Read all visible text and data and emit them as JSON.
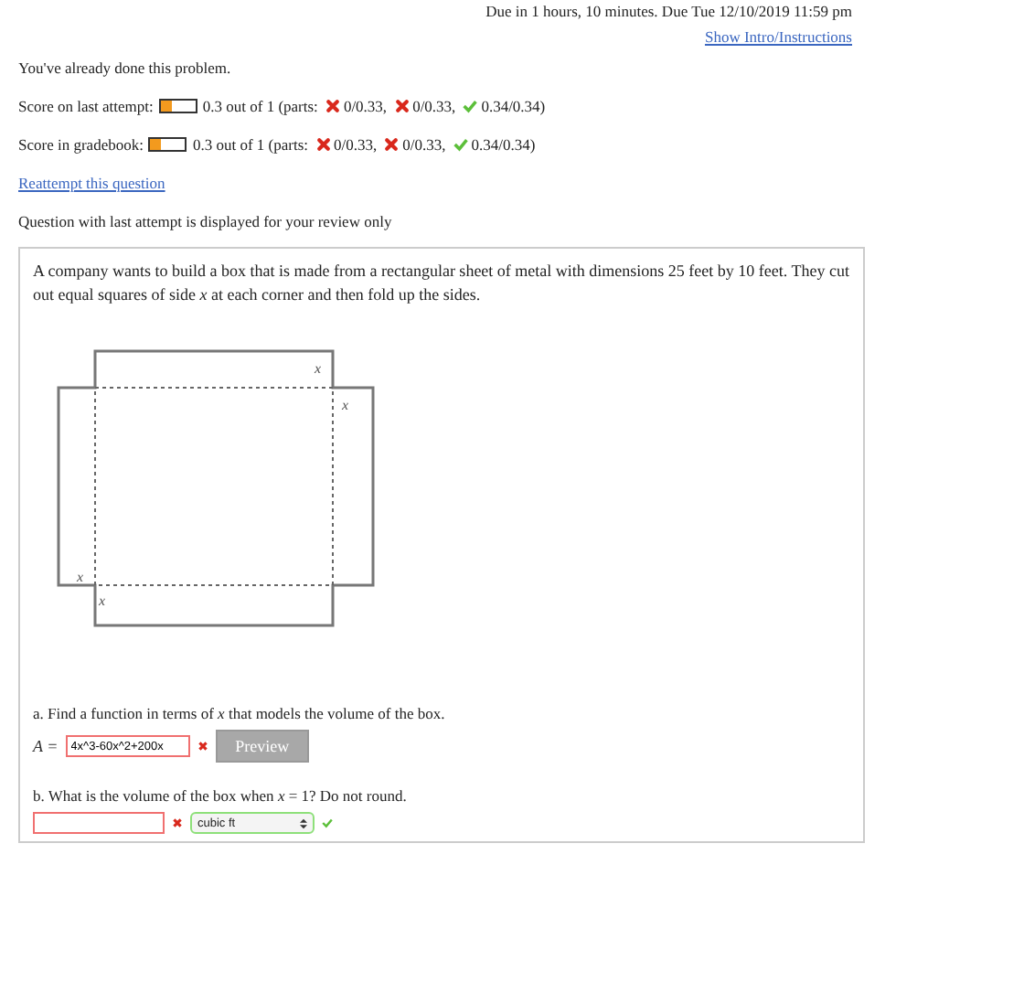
{
  "due": "Due in 1 hours, 10 minutes. Due Tue 12/10/2019 11:59 pm",
  "intro_link": "Show Intro/Instructions",
  "notice": "You've already done this problem.",
  "scores": [
    {
      "label": "Score on last attempt:",
      "level": 0.3,
      "score": "0.3 out of 1 (parts:",
      "parts": [
        {
          "correct": false,
          "text": "0/0.33,"
        },
        {
          "correct": false,
          "text": "0/0.33,"
        },
        {
          "correct": true,
          "text": "0.34/0.34)"
        }
      ]
    },
    {
      "label": "Score in gradebook:",
      "level": 0.3,
      "score": "0.3 out of 1 (parts:",
      "parts": [
        {
          "correct": false,
          "text": "0/0.33,"
        },
        {
          "correct": false,
          "text": "0/0.33,"
        },
        {
          "correct": true,
          "text": "0.34/0.34)"
        }
      ]
    }
  ],
  "reattempt_link": "Reattempt this question",
  "review_note": "Question with last attempt is displayed for your review only",
  "question": {
    "text": "A company wants to build a box that is made from a rectangular sheet of metal with dimensions 25 feet by 10 feet. They cut out equal squares of side *x* at each corner and then fold up the sides.",
    "diagram_labels": [
      "x",
      "x",
      "x",
      "x"
    ],
    "part_a": {
      "prompt": "a. Find a function in terms of *x* that models the volume of the box.",
      "var": "A =",
      "value": "4x^3-60x^2+200x",
      "correct": false,
      "button": "Preview"
    },
    "part_b": {
      "prompt": "b. What is the volume of the box when *x* = 1? Do not round.",
      "correct": false,
      "unit": "cubic ft",
      "unit_correct": true
    }
  }
}
